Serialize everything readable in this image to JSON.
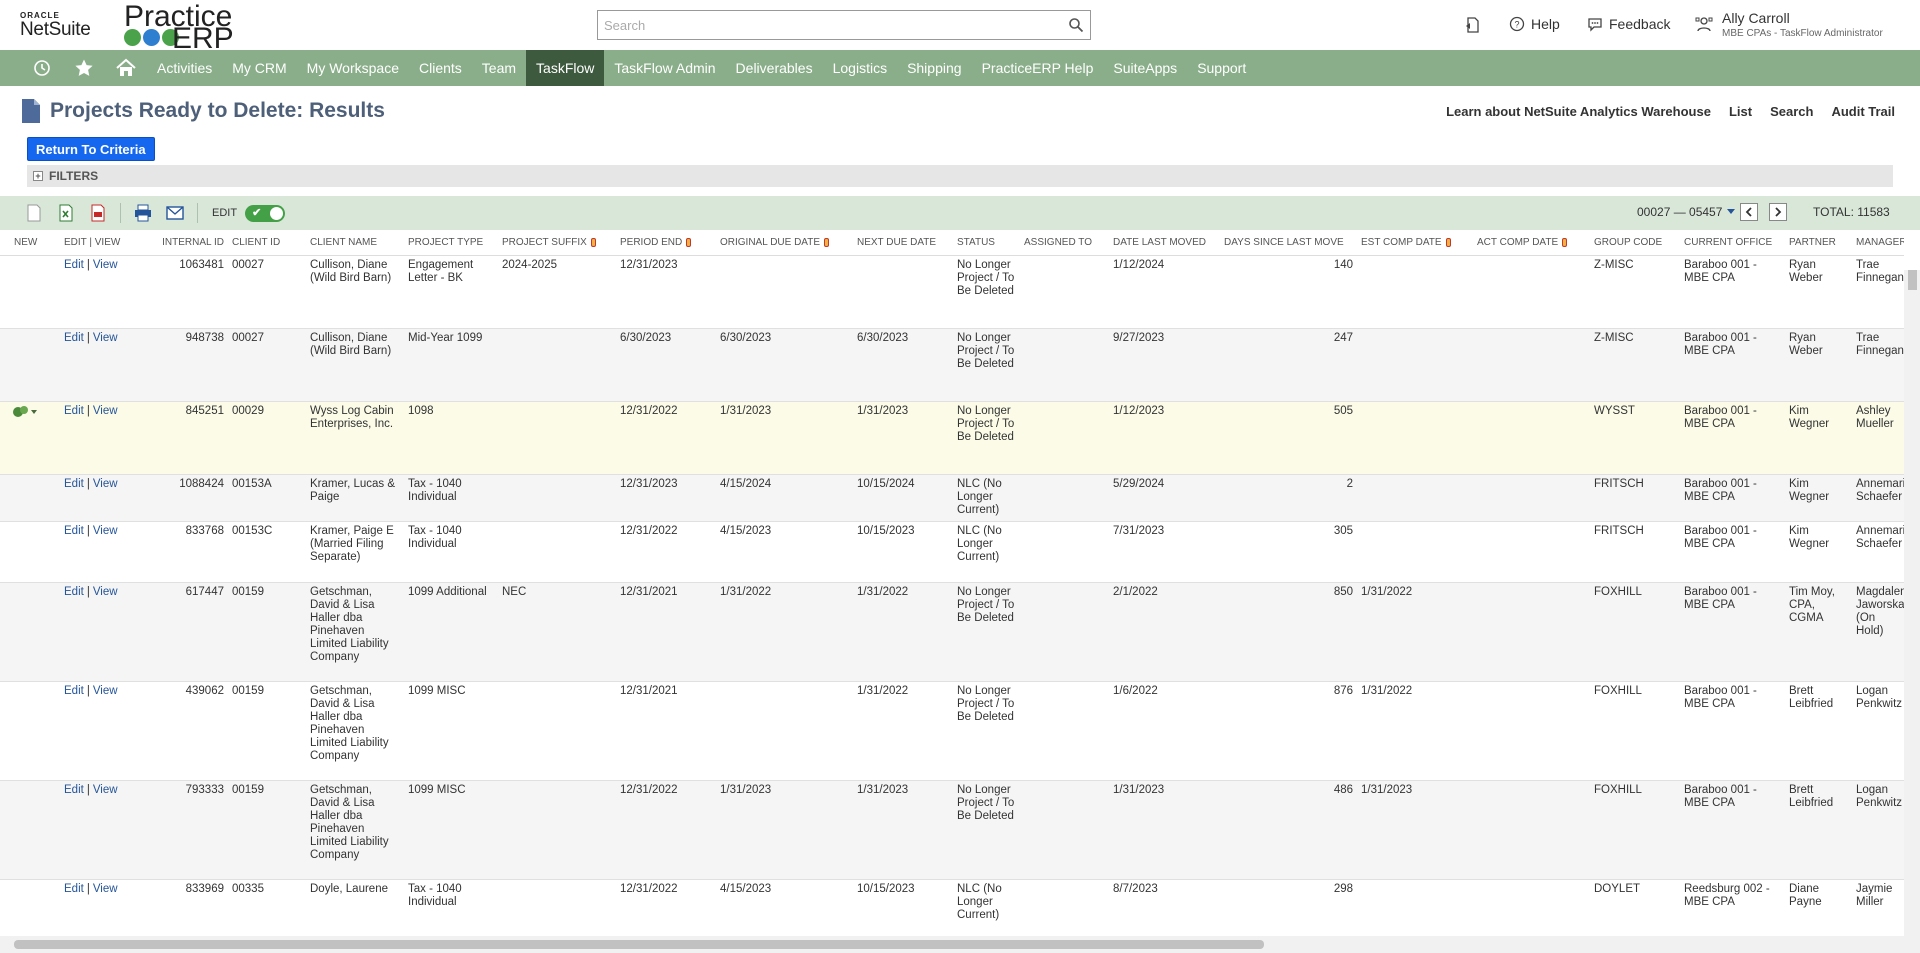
{
  "header": {
    "oracle_label": "ORACLE",
    "netsuite_label": "NetSuite",
    "practice_label": "Practice",
    "erp_label": "ERP",
    "search_placeholder": "Search",
    "help_label": "Help",
    "feedback_label": "Feedback",
    "user_name": "Ally Carroll",
    "user_role": "MBE CPAs - TaskFlow Administrator"
  },
  "nav": {
    "items": [
      "Activities",
      "My CRM",
      "My Workspace",
      "Clients",
      "Team",
      "TaskFlow",
      "TaskFlow Admin",
      "Deliverables",
      "Logistics",
      "Shipping",
      "PracticeERP Help",
      "SuiteApps",
      "Support"
    ],
    "active": "TaskFlow",
    "color": "#8aae8a",
    "active_color": "#3e5a3e"
  },
  "page": {
    "title": "Projects Ready to Delete: Results",
    "links": [
      "Learn about NetSuite Analytics Warehouse",
      "List",
      "Search",
      "Audit Trail"
    ],
    "return_button": "Return To Criteria",
    "filters_label": "FILTERS"
  },
  "toolbar": {
    "edit_label": "EDIT",
    "range": "00027 — 05457",
    "total": "TOTAL: 11583"
  },
  "table": {
    "columns": [
      "NEW",
      "EDIT | VIEW",
      "INTERNAL ID",
      "CLIENT ID",
      "CLIENT NAME",
      "PROJECT TYPE",
      "PROJECT SUFFIX",
      "PERIOD END",
      "ORIGINAL DUE DATE",
      "NEXT DUE DATE",
      "STATUS",
      "ASSIGNED TO",
      "DATE LAST MOVED",
      "DAYS SINCE LAST MOVE",
      "EST COMP DATE",
      "ACT COMP DATE",
      "GROUP CODE",
      "CURRENT OFFICE",
      "PARTNER",
      "MANAGER"
    ],
    "edit_label": "Edit",
    "view_label": "View",
    "rows": [
      {
        "internal_id": "1063481",
        "client_id": "00027",
        "client_name": "Cullison, Diane (Wild Bird Barn)",
        "project_type": "Engagement Letter - BK",
        "suffix": "2024-2025",
        "period_end": "12/31/2023",
        "orig_due": "",
        "next_due": "",
        "status": "No Longer Project / To Be Deleted",
        "assigned": "",
        "last_moved": "1/12/2024",
        "days": "140",
        "est_comp": "",
        "act_comp": "",
        "group": "Z-MISC",
        "office": "Baraboo 001 - MBE CPA",
        "partner": "Ryan Weber",
        "manager": "Trae Finnegan"
      },
      {
        "internal_id": "948738",
        "client_id": "00027",
        "client_name": "Cullison, Diane (Wild Bird Barn)",
        "project_type": "Mid-Year 1099",
        "suffix": "",
        "period_end": "6/30/2023",
        "orig_due": "6/30/2023",
        "next_due": "6/30/2023",
        "status": "No Longer Project / To Be Deleted",
        "assigned": "",
        "last_moved": "9/27/2023",
        "days": "247",
        "est_comp": "",
        "act_comp": "",
        "group": "Z-MISC",
        "office": "Baraboo 001 - MBE CPA",
        "partner": "Ryan Weber",
        "manager": "Trae Finnegan"
      },
      {
        "internal_id": "845251",
        "client_id": "00029",
        "client_name": "Wyss Log Cabin Enterprises, Inc.",
        "project_type": "1098",
        "suffix": "",
        "period_end": "12/31/2022",
        "orig_due": "1/31/2023",
        "next_due": "1/31/2023",
        "status": "No Longer Project / To Be Deleted",
        "assigned": "",
        "last_moved": "1/12/2023",
        "days": "505",
        "est_comp": "",
        "act_comp": "",
        "group": "WYSST",
        "office": "Baraboo 001 - MBE CPA",
        "partner": "Kim Wegner",
        "manager": "Ashley Mueller"
      },
      {
        "internal_id": "1088424",
        "client_id": "00153A",
        "client_name": "Kramer, Lucas & Paige",
        "project_type": "Tax - 1040 Individual",
        "suffix": "",
        "period_end": "12/31/2023",
        "orig_due": "4/15/2024",
        "next_due": "10/15/2024",
        "status": "NLC (No Longer Current)",
        "assigned": "",
        "last_moved": "5/29/2024",
        "days": "2",
        "est_comp": "",
        "act_comp": "",
        "group": "FRITSCH",
        "office": "Baraboo 001 - MBE CPA",
        "partner": "Kim Wegner",
        "manager": "Annemarie Schaefer"
      },
      {
        "internal_id": "833768",
        "client_id": "00153C",
        "client_name": "Kramer, Paige E (Married Filing Separate)",
        "project_type": "Tax - 1040 Individual",
        "suffix": "",
        "period_end": "12/31/2022",
        "orig_due": "4/15/2023",
        "next_due": "10/15/2023",
        "status": "NLC (No Longer Current)",
        "assigned": "",
        "last_moved": "7/31/2023",
        "days": "305",
        "est_comp": "",
        "act_comp": "",
        "group": "FRITSCH",
        "office": "Baraboo 001 - MBE CPA",
        "partner": "Kim Wegner",
        "manager": "Annemarie Schaefer"
      },
      {
        "internal_id": "617447",
        "client_id": "00159",
        "client_name": "Getschman, David & Lisa Haller dba Pinehaven Limited Liability Company",
        "project_type": "1099 Additional",
        "suffix": "NEC",
        "period_end": "12/31/2021",
        "orig_due": "1/31/2022",
        "next_due": "1/31/2022",
        "status": "No Longer Project / To Be Deleted",
        "assigned": "",
        "last_moved": "2/1/2022",
        "days": "850",
        "est_comp": "1/31/2022",
        "act_comp": "",
        "group": "FOXHILL",
        "office": "Baraboo 001 - MBE CPA",
        "partner": "Tim Moy, CPA, CGMA",
        "manager": "Magdalena Jaworska (On Hold)"
      },
      {
        "internal_id": "439062",
        "client_id": "00159",
        "client_name": "Getschman, David & Lisa Haller dba Pinehaven Limited Liability Company",
        "project_type": "1099 MISC",
        "suffix": "",
        "period_end": "12/31/2021",
        "orig_due": "",
        "next_due": "1/31/2022",
        "status": "No Longer Project / To Be Deleted",
        "assigned": "",
        "last_moved": "1/6/2022",
        "days": "876",
        "est_comp": "1/31/2022",
        "act_comp": "",
        "group": "FOXHILL",
        "office": "Baraboo 001 - MBE CPA",
        "partner": "Brett Leibfried",
        "manager": "Logan Penkwitz"
      },
      {
        "internal_id": "793333",
        "client_id": "00159",
        "client_name": "Getschman, David & Lisa Haller dba Pinehaven Limited Liability Company",
        "project_type": "1099 MISC",
        "suffix": "",
        "period_end": "12/31/2022",
        "orig_due": "1/31/2023",
        "next_due": "1/31/2023",
        "status": "No Longer Project / To Be Deleted",
        "assigned": "",
        "last_moved": "1/31/2023",
        "days": "486",
        "est_comp": "1/31/2023",
        "act_comp": "",
        "group": "FOXHILL",
        "office": "Baraboo 001 - MBE CPA",
        "partner": "Brett Leibfried",
        "manager": "Logan Penkwitz"
      },
      {
        "internal_id": "833969",
        "client_id": "00335",
        "client_name": "Doyle, Laurene",
        "project_type": "Tax - 1040 Individual",
        "suffix": "",
        "period_end": "12/31/2022",
        "orig_due": "4/15/2023",
        "next_due": "10/15/2023",
        "status": "NLC (No Longer Current)",
        "assigned": "",
        "last_moved": "8/7/2023",
        "days": "298",
        "est_comp": "",
        "act_comp": "",
        "group": "DOYLET",
        "office": "Reedsburg 002 - MBE CPA",
        "partner": "Diane Payne",
        "manager": "Jaymie Miller"
      }
    ]
  }
}
